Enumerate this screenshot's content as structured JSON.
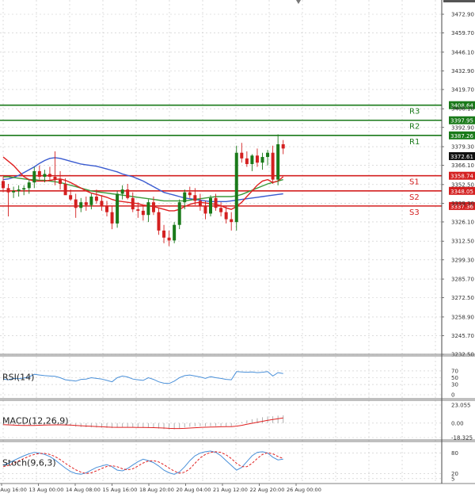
{
  "chart_data": {
    "type": "candlestick",
    "main": {
      "ylim": [
        3232.5,
        3478.5
      ],
      "ticks": [
        "3472.90",
        "3459.70",
        "3446.10",
        "3432.90",
        "3419.70",
        "3406.10",
        "3392.90",
        "3379.30",
        "3366.10",
        "3352.50",
        "3339.30",
        "3326.10",
        "3312.50",
        "3299.30",
        "3285.70",
        "3272.50",
        "3258.90",
        "3245.70",
        "3232.50"
      ],
      "ohlc": [
        [
          3355,
          3358,
          3347,
          3350
        ],
        [
          3350,
          3353,
          3330,
          3347
        ],
        [
          3347,
          3351,
          3343,
          3348
        ],
        [
          3348,
          3352,
          3344,
          3349
        ],
        [
          3349,
          3352,
          3345,
          3350
        ],
        [
          3350,
          3356,
          3346,
          3354
        ],
        [
          3354,
          3365,
          3350,
          3362
        ],
        [
          3362,
          3366,
          3356,
          3358
        ],
        [
          3358,
          3363,
          3354,
          3360
        ],
        [
          3360,
          3365,
          3356,
          3358
        ],
        [
          3358,
          3376,
          3352,
          3356
        ],
        [
          3356,
          3362,
          3349,
          3353
        ],
        [
          3353,
          3357,
          3346,
          3345
        ],
        [
          3345,
          3349,
          3341,
          3342
        ],
        [
          3342,
          3346,
          3329,
          3336
        ],
        [
          3336,
          3343,
          3333,
          3340
        ],
        [
          3340,
          3344,
          3334,
          3338
        ],
        [
          3338,
          3346,
          3335,
          3344
        ],
        [
          3344,
          3349,
          3339,
          3341
        ],
        [
          3341,
          3345,
          3334,
          3337
        ],
        [
          3337,
          3341,
          3330,
          3333
        ],
        [
          3333,
          3337,
          3321,
          3325
        ],
        [
          3325,
          3348,
          3322,
          3346
        ],
        [
          3346,
          3352,
          3342,
          3349
        ],
        [
          3349,
          3353,
          3342,
          3343
        ],
        [
          3343,
          3347,
          3333,
          3335
        ],
        [
          3335,
          3340,
          3329,
          3334
        ],
        [
          3334,
          3338,
          3327,
          3331
        ],
        [
          3331,
          3342,
          3326,
          3340
        ],
        [
          3340,
          3344,
          3331,
          3333
        ],
        [
          3333,
          3336,
          3317,
          3320
        ],
        [
          3320,
          3324,
          3311,
          3315
        ],
        [
          3315,
          3320,
          3309,
          3313
        ],
        [
          3313,
          3326,
          3311,
          3324
        ],
        [
          3324,
          3342,
          3321,
          3340
        ],
        [
          3340,
          3349,
          3335,
          3347
        ],
        [
          3347,
          3351,
          3343,
          3345
        ],
        [
          3345,
          3350,
          3338,
          3341
        ],
        [
          3341,
          3346,
          3334,
          3337
        ],
        [
          3337,
          3341,
          3328,
          3332
        ],
        [
          3332,
          3345,
          3330,
          3343
        ],
        [
          3343,
          3346,
          3334,
          3336
        ],
        [
          3336,
          3340,
          3330,
          3333
        ],
        [
          3333,
          3337,
          3325,
          3328
        ],
        [
          3328,
          3333,
          3320,
          3326
        ],
        [
          3326,
          3380,
          3320,
          3375
        ],
        [
          3375,
          3382,
          3368,
          3371
        ],
        [
          3371,
          3376,
          3365,
          3367
        ],
        [
          3367,
          3374,
          3362,
          3373
        ],
        [
          3373,
          3378,
          3365,
          3368
        ],
        [
          3368,
          3375,
          3363,
          3372
        ],
        [
          3372,
          3377,
          3366,
          3375
        ],
        [
          3375,
          3380,
          3353,
          3356
        ],
        [
          3356,
          3388,
          3352,
          3381
        ],
        [
          3381,
          3384,
          3374,
          3378
        ]
      ],
      "ma_slow": [
        3356,
        3356.5,
        3357.5,
        3359,
        3361,
        3363,
        3365,
        3367.5,
        3369.5,
        3371,
        3371.5,
        3371,
        3370,
        3369,
        3368,
        3367,
        3366.5,
        3366,
        3365.5,
        3364.5,
        3363.5,
        3362.5,
        3361.5,
        3360,
        3359,
        3358,
        3356.5,
        3355,
        3353,
        3351,
        3349,
        3347,
        3346,
        3345,
        3344,
        3343,
        3342.5,
        3342,
        3341.5,
        3341,
        3340.5,
        3340.5,
        3340.5,
        3340.5,
        3341,
        3341.5,
        3342,
        3342.5,
        3343,
        3343.5,
        3344,
        3344.5,
        3345,
        3345.5,
        3346
      ],
      "ma_mid": [
        3358,
        3358,
        3357.5,
        3357,
        3356.5,
        3356,
        3356,
        3355.5,
        3355.5,
        3355,
        3354.5,
        3354,
        3353,
        3352,
        3351,
        3350,
        3349,
        3348,
        3347.5,
        3347,
        3346.5,
        3346,
        3345.5,
        3345,
        3344.5,
        3344,
        3343.5,
        3343,
        3342.5,
        3342,
        3341.5,
        3341,
        3341,
        3341,
        3341,
        3341,
        3341.5,
        3342,
        3342.5,
        3343,
        3343.5,
        3344,
        3344,
        3344,
        3344,
        3344.5,
        3345.5,
        3347,
        3348.5,
        3350,
        3351.5,
        3353,
        3354,
        3355,
        3356
      ],
      "ma_fast": [
        3372,
        3369,
        3366,
        3362,
        3358,
        3356,
        3355,
        3355,
        3355,
        3355.5,
        3356,
        3356.5,
        3355.5,
        3354,
        3352,
        3350,
        3348,
        3346.5,
        3345.5,
        3344.5,
        3343.5,
        3342,
        3341,
        3340.5,
        3340,
        3339.5,
        3339,
        3338,
        3337.5,
        3337,
        3336,
        3335,
        3334,
        3334,
        3335,
        3337,
        3338.5,
        3339.5,
        3340,
        3339.5,
        3339,
        3338.5,
        3337.5,
        3336,
        3335,
        3337,
        3340,
        3344,
        3348,
        3352,
        3355,
        3356,
        3354,
        3355,
        3358
      ]
    },
    "levels": [
      {
        "name": "R3",
        "value": 3408.64,
        "label": "3408.64",
        "color": "#1a7a1a"
      },
      {
        "name": "R2",
        "value": 3397.95,
        "label": "3397.95",
        "color": "#1a7a1a"
      },
      {
        "name": "R1",
        "value": 3387.26,
        "label": "3387.26",
        "color": "#1a7a1a"
      },
      {
        "name": "S1",
        "value": 3358.74,
        "label": "3358.74",
        "color": "#d42020"
      },
      {
        "name": "S2",
        "value": 3348.05,
        "label": "3348.05",
        "color": "#d42020"
      },
      {
        "name": "S3",
        "value": 3337.36,
        "label": "3337.36",
        "color": "#d42020"
      }
    ],
    "last_price": {
      "value": 3372.61,
      "label": "3372.61"
    },
    "rsi": {
      "title": "RSI(14)",
      "ticks": [
        "70",
        "50",
        "30",
        "0"
      ],
      "ylim": [
        0,
        100
      ],
      "values": [
        46,
        44,
        48,
        47,
        49,
        52,
        60,
        58,
        56,
        55,
        54,
        50,
        44,
        42,
        40,
        45,
        46,
        50,
        48,
        46,
        42,
        38,
        50,
        55,
        52,
        46,
        44,
        42,
        50,
        45,
        38,
        34,
        33,
        40,
        50,
        56,
        58,
        55,
        52,
        48,
        53,
        50,
        48,
        45,
        44,
        68,
        67,
        66,
        67,
        65,
        66,
        68,
        55,
        65,
        62
      ]
    },
    "macd": {
      "title": "MACD(12,26,9)",
      "ticks": [
        "23.055",
        "0.00",
        "-18.325"
      ],
      "ylim": [
        -18.325,
        23.055
      ],
      "values": [
        -2,
        -2.5,
        -3,
        -3,
        -3.2,
        -3,
        -2.5,
        -1.8,
        -1.5,
        -1.5,
        -1.6,
        -2,
        -2.8,
        -3.5,
        -4.5,
        -5,
        -5.2,
        -5.3,
        -5.5,
        -5.8,
        -6,
        -6.3,
        -5.5,
        -5,
        -5,
        -5.3,
        -5.6,
        -6,
        -5.8,
        -6,
        -6.8,
        -7.5,
        -8,
        -7.8,
        -6.8,
        -5.5,
        -4.5,
        -4,
        -3.8,
        -4,
        -3.8,
        -3.7,
        -3.7,
        -4,
        -4,
        -1,
        1.5,
        3.5,
        5,
        6.3,
        7.5,
        8.5,
        8.8,
        9.6,
        10
      ],
      "signal": [
        -2,
        -2.2,
        -2.5,
        -2.8,
        -3,
        -3,
        -2.9,
        -2.7,
        -2.5,
        -2.3,
        -2.2,
        -2.2,
        -2.3,
        -2.5,
        -2.9,
        -3.3,
        -3.7,
        -4,
        -4.3,
        -4.6,
        -4.9,
        -5.2,
        -5.3,
        -5.3,
        -5.3,
        -5.3,
        -5.4,
        -5.5,
        -5.6,
        -5.7,
        -5.9,
        -6.2,
        -6.6,
        -6.8,
        -6.8,
        -6.6,
        -6.2,
        -5.8,
        -5.4,
        -5.2,
        -5,
        -4.8,
        -4.6,
        -4.5,
        -4.4,
        -3.8,
        -2.8,
        -1.5,
        -0.2,
        1.1,
        2.4,
        3.6,
        4.7,
        5.7,
        6.6
      ]
    },
    "stoch": {
      "title": "Stoch(9,6,3)",
      "ticks": [
        "80",
        "20",
        "5"
      ],
      "ylim": [
        0,
        100
      ],
      "k": [
        45,
        50,
        58,
        65,
        72,
        78,
        82,
        80,
        76,
        70,
        60,
        48,
        36,
        26,
        20,
        18,
        22,
        30,
        38,
        42,
        46,
        40,
        30,
        28,
        35,
        45,
        55,
        62,
        58,
        52,
        42,
        30,
        22,
        18,
        25,
        40,
        58,
        72,
        80,
        84,
        86,
        82,
        72,
        58,
        44,
        30,
        38,
        55,
        72,
        82,
        84,
        80,
        68,
        60,
        62
      ],
      "d": [
        40,
        44,
        50,
        57,
        64,
        71,
        76,
        79,
        79,
        76,
        70,
        61,
        50,
        40,
        31,
        24,
        20,
        22,
        28,
        35,
        41,
        43,
        40,
        34,
        31,
        34,
        42,
        51,
        57,
        58,
        54,
        46,
        36,
        27,
        21,
        24,
        34,
        50,
        66,
        76,
        82,
        84,
        82,
        75,
        64,
        50,
        40,
        40,
        50,
        64,
        76,
        81,
        78,
        70,
        64
      ]
    },
    "x_ticks": [
      "12 Aug 16:00",
      "13 Aug 00:00",
      "14 Aug 08:00",
      "15 Aug 16:00",
      "18 Aug 20:00",
      "20 Aug 04:00",
      "21 Aug 12:00",
      "22 Aug 20:00",
      "26 Aug 00:00"
    ],
    "colors": {
      "up": "#1a7a1a",
      "down": "#d42020",
      "ma_slow": "#3a5bd0",
      "ma_mid": "#3a9a3a",
      "ma_fast": "#e02020",
      "line": "#4a90d9",
      "grid": "#c8c8c8"
    }
  }
}
